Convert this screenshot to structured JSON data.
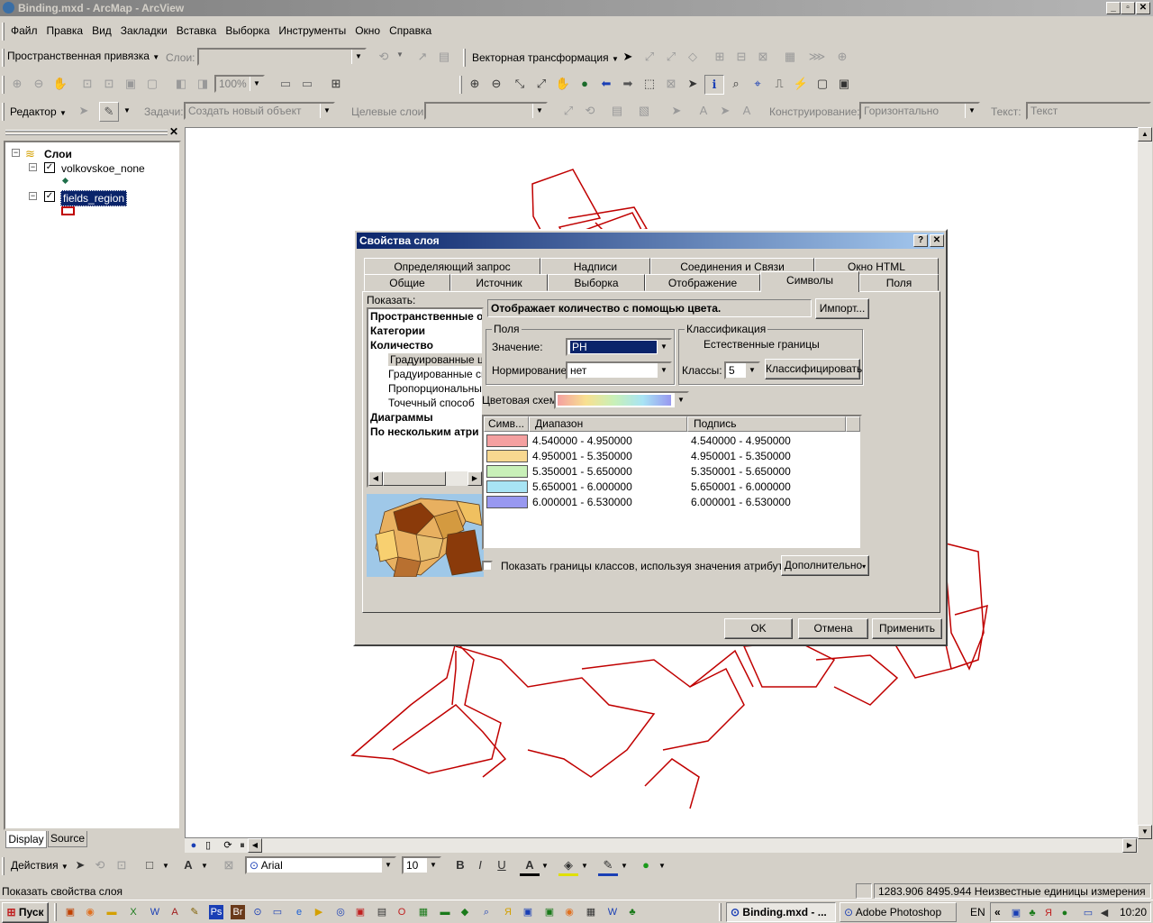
{
  "window": {
    "title": "Binding.mxd - ArcMap - ArcView"
  },
  "menu": [
    "Файл",
    "Правка",
    "Вид",
    "Закладки",
    "Вставка",
    "Выборка",
    "Инструменты",
    "Окно",
    "Справка"
  ],
  "toolbar1": {
    "georef_label": "Пространственная привязка",
    "layer_label": "Слои:",
    "layer_value": "",
    "vector_label": "Векторная трансформация"
  },
  "toolbar2": {
    "zoom_value": "100%"
  },
  "toolbar3": {
    "editor_label": "Редактор",
    "task_label": "Задачи:",
    "task_value": "Создать новый объект",
    "target_label": "Целевые слои:",
    "target_value": "",
    "construct_label": "Конструирование:",
    "construct_value": "Горизонтально",
    "text_label": "Текст:",
    "text_value": "Текст"
  },
  "toc": {
    "root": "Слои",
    "layers": [
      {
        "name": "volkovskoe_none",
        "checked": true
      },
      {
        "name": "fields_region",
        "checked": true
      }
    ],
    "tabs": [
      "Display",
      "Source"
    ]
  },
  "dialog": {
    "title": "Свойства слоя",
    "tabs_row1": [
      "Определяющий запрос",
      "Надписи",
      "Соединения и Связи",
      "Окно HTML"
    ],
    "tabs_row2": [
      "Общие",
      "Источник",
      "Выборка",
      "Отображение",
      "Символы",
      "Поля"
    ],
    "active_tab": "Символы",
    "show_label": "Показать:",
    "show_list": [
      {
        "text": "Пространственные о",
        "bold": true,
        "indent": false
      },
      {
        "text": "Категории",
        "bold": true,
        "indent": false
      },
      {
        "text": "Количество",
        "bold": true,
        "indent": false
      },
      {
        "text": "Градуированные цве",
        "bold": false,
        "indent": true,
        "selected": true
      },
      {
        "text": "Градуированные сим",
        "bold": false,
        "indent": true
      },
      {
        "text": "Пропорциональные",
        "bold": false,
        "indent": true
      },
      {
        "text": "Точечный способ",
        "bold": false,
        "indent": true
      },
      {
        "text": "Диаграммы",
        "bold": true,
        "indent": false
      },
      {
        "text": "По нескольким атри",
        "bold": true,
        "indent": false
      }
    ],
    "description": "Отображает количество с помощью цвета.",
    "import_label": "Импорт...",
    "fields_group": "Поля",
    "value_label": "Значение:",
    "value_selected": "PH",
    "normalization_label": "Нормирование:",
    "normalization_selected": "нет",
    "classification_group": "Классификация",
    "classification_method": "Естественные границы",
    "classes_label": "Классы:",
    "classes_value": "5",
    "classify_button": "Классифицировать",
    "color_scheme_label": "Цветовая схем",
    "table_headers": [
      "Симв...",
      "Диапазон",
      "Подпись"
    ],
    "classes": [
      {
        "color": "#f4a0a0",
        "range": "4.540000 - 4.950000",
        "label": "4.540000 - 4.950000"
      },
      {
        "color": "#f8d890",
        "range": "4.950001 - 5.350000",
        "label": "4.950001 - 5.350000"
      },
      {
        "color": "#c8f0b8",
        "range": "5.350001 - 5.650000",
        "label": "5.350001 - 5.650000"
      },
      {
        "color": "#a8e4f4",
        "range": "5.650001 - 6.000000",
        "label": "5.650001 - 6.000000"
      },
      {
        "color": "#9898f0",
        "range": "6.000001 - 6.530000",
        "label": "6.000001 - 6.530000"
      }
    ],
    "show_bounds_label": "Показать границы классов, используя значения атрибутов",
    "advanced_label": "Дополнительно",
    "ok_label": "OK",
    "cancel_label": "Отмена",
    "apply_label": "Применить"
  },
  "draw_toolbar": {
    "actions_label": "Действия",
    "font_name": "Arial",
    "font_size": "10"
  },
  "status": {
    "text": "Показать свойства слоя",
    "coords": "1283.906  8495.944 Неизвестные единицы измерения"
  },
  "taskbar": {
    "start_label": "Пуск",
    "tasks": [
      "Binding.mxd - ...",
      "Adobe Photoshop"
    ],
    "lang": "EN",
    "clock": "10:20"
  },
  "colors": {
    "polygon_stroke": "#c00000",
    "dialog_title": "#0a246a",
    "selection": "#0a246a"
  }
}
